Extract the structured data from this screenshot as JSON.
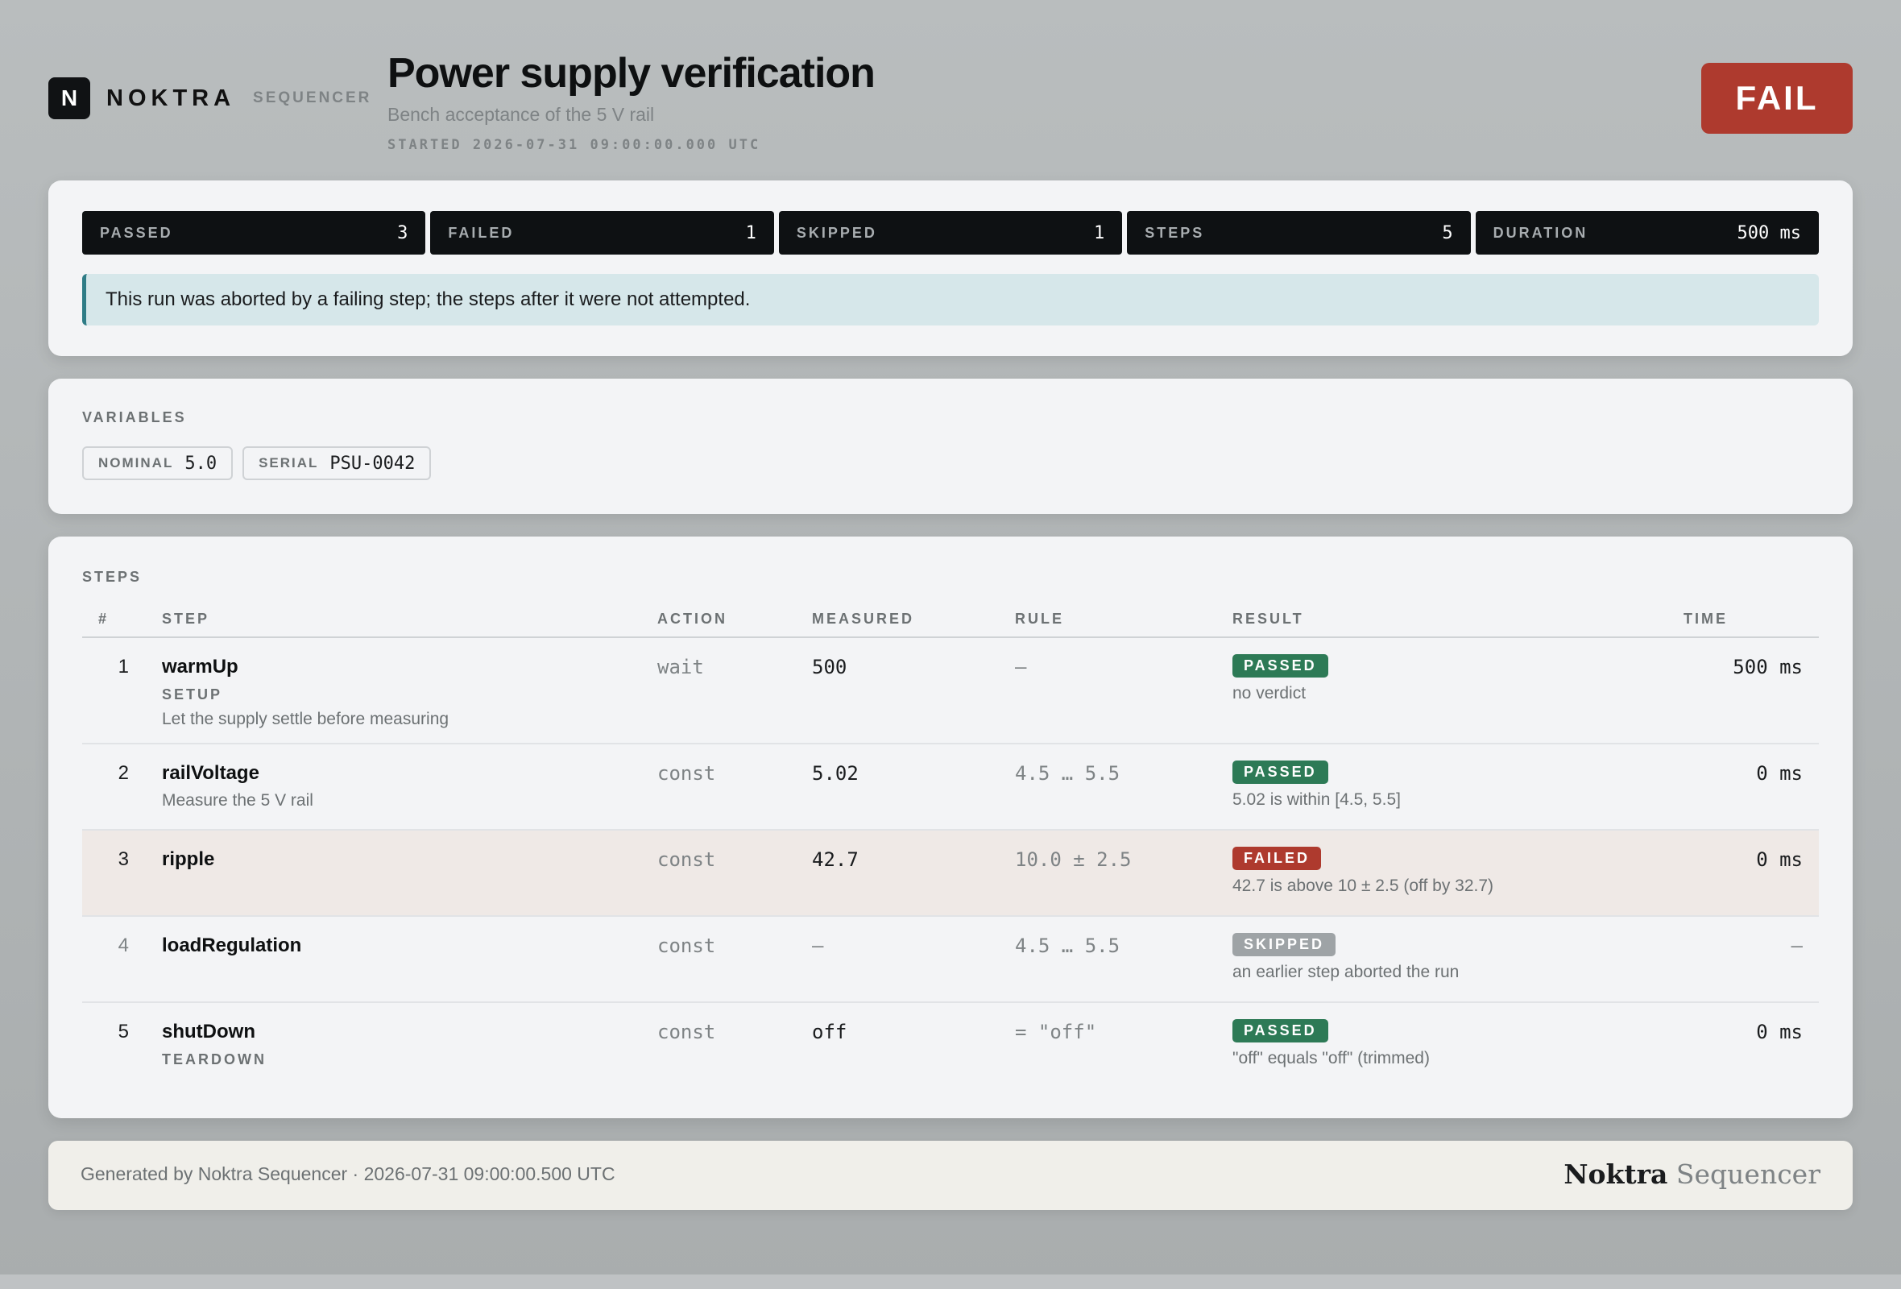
{
  "brand": {
    "mark": "N",
    "name": "NOKTRA",
    "product": "SEQUENCER"
  },
  "header": {
    "title": "Power supply verification",
    "subtitle": "Bench acceptance of the 5 V rail",
    "started": "STARTED 2026-07-31 09:00:00.000 UTC",
    "verdict": "FAIL",
    "verdict_color": "#ae3a2e"
  },
  "summary": {
    "stats": [
      {
        "label": "PASSED",
        "value": "3"
      },
      {
        "label": "FAILED",
        "value": "1"
      },
      {
        "label": "SKIPPED",
        "value": "1"
      },
      {
        "label": "STEPS",
        "value": "5"
      },
      {
        "label": "DURATION",
        "value": "500 ms"
      }
    ],
    "notice": "This run was aborted by a failing step; the steps after it were not attempted."
  },
  "variables": {
    "label": "VARIABLES",
    "items": [
      {
        "key": "NOMINAL",
        "value": "5.0"
      },
      {
        "key": "SERIAL",
        "value": "PSU-0042"
      }
    ]
  },
  "steps": {
    "label": "STEPS",
    "columns": {
      "num": "#",
      "step": "STEP",
      "action": "ACTION",
      "measured": "MEASURED",
      "rule": "RULE",
      "result": "RESULT",
      "time": "TIME"
    },
    "rows": [
      {
        "num": "1",
        "name": "warmUp",
        "tag": "SETUP",
        "desc": "Let the supply settle before measuring",
        "action": "wait",
        "measured": "500",
        "rule": "—",
        "status": "PASSED",
        "note": "no verdict",
        "time": "500 ms"
      },
      {
        "num": "2",
        "name": "railVoltage",
        "tag": "",
        "desc": "Measure the 5 V rail",
        "action": "const",
        "measured": "5.02",
        "rule": "4.5 … 5.5",
        "status": "PASSED",
        "note": "5.02 is within [4.5, 5.5]",
        "time": "0 ms"
      },
      {
        "num": "3",
        "name": "ripple",
        "tag": "",
        "desc": "",
        "action": "const",
        "measured": "42.7",
        "rule": "10.0 ± 2.5",
        "status": "FAILED",
        "note": "42.7 is above 10 ± 2.5 (off by 32.7)",
        "time": "0 ms"
      },
      {
        "num": "4",
        "name": "loadRegulation",
        "tag": "",
        "desc": "",
        "action": "const",
        "measured": "—",
        "rule": "4.5 … 5.5",
        "status": "SKIPPED",
        "note": "an earlier step aborted the run",
        "time": "—"
      },
      {
        "num": "5",
        "name": "shutDown",
        "tag": "TEARDOWN",
        "desc": "",
        "action": "const",
        "measured": "off",
        "rule": "= \"off\"",
        "status": "PASSED",
        "note": "\"off\" equals \"off\" (trimmed)",
        "time": "0 ms"
      }
    ]
  },
  "footer": {
    "text": "Generated by Noktra Sequencer · 2026-07-31 09:00:00.500 UTC",
    "brand_main": "Noktra",
    "brand_sub": "Sequencer"
  },
  "colors": {
    "passed": "#2d7a56",
    "failed": "#ae3a2e",
    "skipped": "#9ea3a6",
    "notice_accent": "#2f7c86"
  }
}
